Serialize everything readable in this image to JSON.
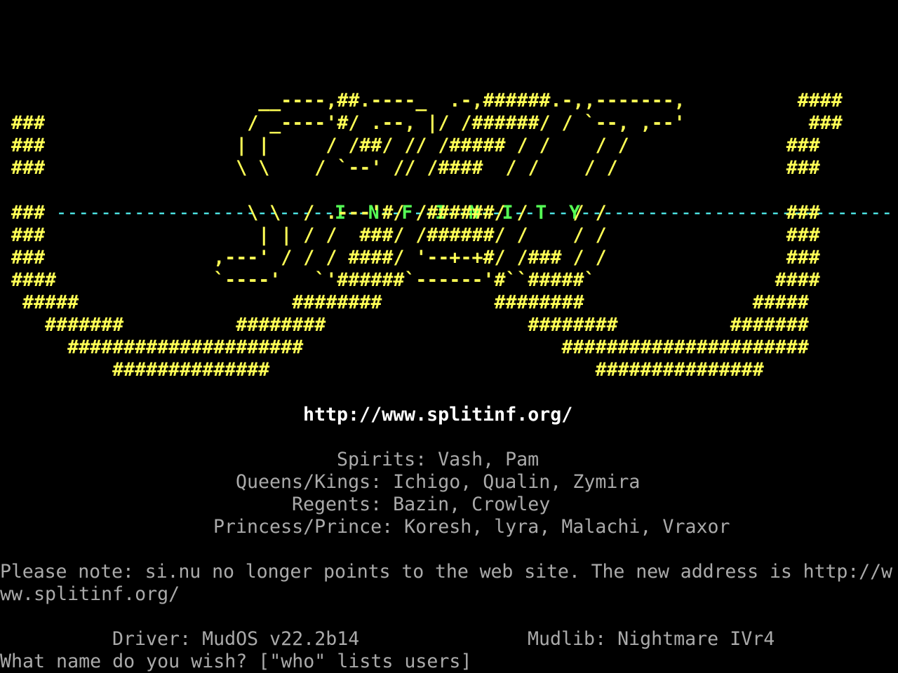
{
  "banner": {
    "art_lines": [
      "                       __----,##.----_  .-,######.-,,-------,          ####",
      " ###                  / _----'#/ .--, |/ /######/ / `--, ,--'           ###",
      " ###                 | |     / /##/ // /##### / /    / /              ###",
      " ###                 \\ \\    / `--' // /####  / /    / /               ###",
      " ###                  \\ \\  / .---'#/ /######/ /    / /                ###",
      " ###                   | | / /  ###/ /######/ /    / /                ###",
      " ###               ,---' / / / ####/ '--+-+#/ /### / /                ###",
      " ####              `----'   `'######`------'#``#####`                ####",
      "  #####                   ########          ########               #####",
      "    #######          ########                  ########          #######",
      "      #####################                       ######################",
      "          ##############                             ###############"
    ],
    "divider_left": " -------------------------",
    "divider_letters": [
      "I",
      "N",
      "F",
      "I",
      "N",
      "I",
      "T",
      "Y"
    ],
    "divider_right": "----------------------------"
  },
  "url": "http://www.splitinf.org/",
  "staff": [
    "Spirits: Vash, Pam",
    "Queens/Kings: Ichigo, Qualin, Zymira",
    "Regents: Bazin, Crowley",
    "Princess/Prince: Koresh, lyra, Malachi, Vraxor"
  ],
  "notice": {
    "line1": "Please note: si.nu no longer points to the web site. The new address is http://w",
    "line2": "ww.splitinf.org/"
  },
  "footer": {
    "driver": "Driver: MudOS v22.2b14",
    "mudlib": "Mudlib: Nightmare IVr4"
  },
  "prompt": "What name do you wish? [\"who\" lists users]"
}
